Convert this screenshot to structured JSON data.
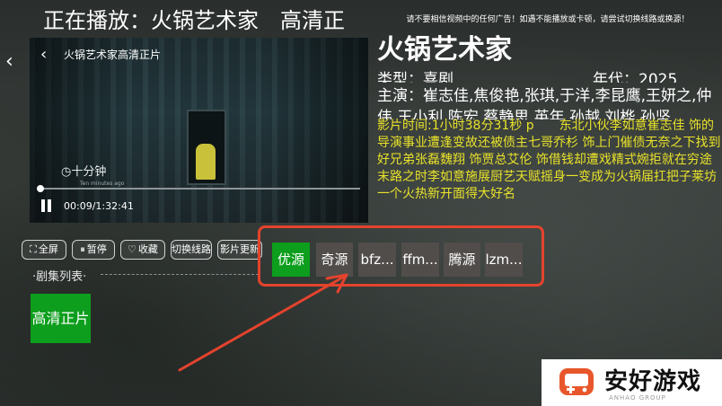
{
  "header": {
    "now_playing": "正在播放：火锅艺术家　高清正",
    "notice": "请不要相信视频中的任何广告！如遇不能播放或卡顿，请尝试切换线路或换源！"
  },
  "player": {
    "title": "火锅艺术家高清正片",
    "badge": "十分钟",
    "badge_sub": "Ten minutes ago",
    "current_time": "00:09",
    "duration": "1:32:41",
    "time_display": "00:09/1:32:41",
    "progress": 0.002
  },
  "movie": {
    "title": "火锅艺术家",
    "type_line": "类型：喜剧",
    "year_line": "年代：2025",
    "cast_line": "主演：崔志佳,焦俊艳,张琪,于洋,李昆鹰,王妍之,仲伟,王小利,陈宏,蔡静思,英年,孙越,刘桦,孙坚",
    "synopsis": "影片时间:1小时38分31秒 p　　东北小伙李如意崔志佳 饰的导演事业遭逢变故还被债主七哥乔杉 饰上门催债无奈之下找到好兄弟张磊魏翔 饰贾总艾伦 饰借钱却遭戏精式婉拒就在穷途末路之时李如意施展厨艺天赋摇身一变成为火锅届扛把子莱坊一个火热新开面得大好名"
  },
  "controls": {
    "fullscreen": "全屏",
    "pause": "暂停",
    "favorite": "收藏",
    "switch_line": "切换线路",
    "movie_update": "影片更新"
  },
  "episodes": {
    "label": "·剧集列表·",
    "items": [
      "高清正片"
    ]
  },
  "sources": [
    "优源",
    "奇源",
    "bfz...",
    "ffm...",
    "腾源",
    "lzm..."
  ],
  "active_source": "优源",
  "logo": {
    "name": "安好游戏",
    "sub": "ANHAO GROUP"
  },
  "colors": {
    "active_green": "#0d9e1d",
    "highlight_red": "#e5432d",
    "synopsis_yellow": "#e8e22a"
  }
}
